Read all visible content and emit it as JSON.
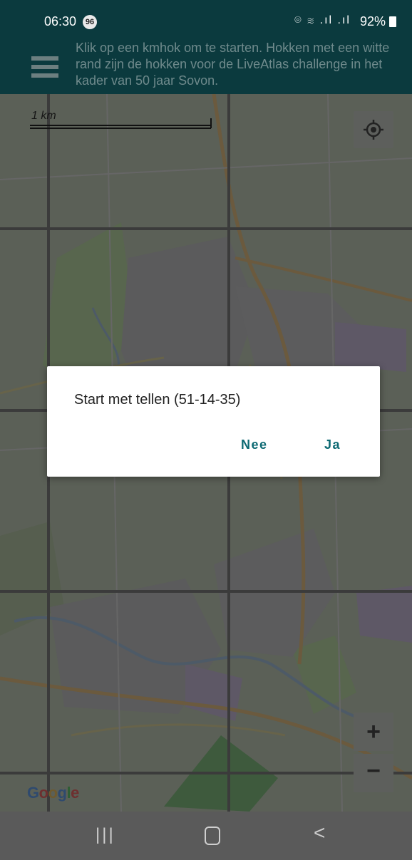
{
  "status_bar": {
    "time": "06:30",
    "notification_count": "96",
    "signal_icons": "⌾ ≋ .ıl .ıl",
    "battery": "92%"
  },
  "header": {
    "message": "Klik op een kmhok om te starten. Hokken met een witte rand zijn de hokken voor de LiveAtlas challenge in het kader van 50 jaar Sovon."
  },
  "map": {
    "scale_label": "1 km",
    "attribution": "Google",
    "zoom_in_label": "+",
    "zoom_out_label": "−",
    "locate_icon": "gps-crosshair-icon"
  },
  "dialog": {
    "title": "Start met tellen (51-14-35)",
    "cancel_label": "Nee",
    "confirm_label": "Ja"
  },
  "nav": {
    "recent_label": "|||",
    "back_label": "<"
  },
  "colors": {
    "header": "#0b3a3e",
    "dialog_button": "#0d6a73",
    "map_dim": "#5a5f56"
  }
}
